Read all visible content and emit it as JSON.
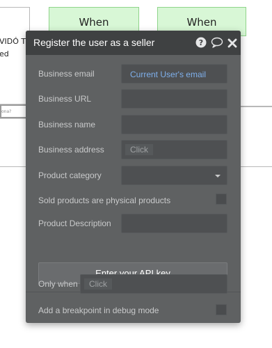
{
  "background": {
    "left_card": {
      "line1": "VIDÓ TU",
      "line2": "ed"
    },
    "when_cards": [
      "When",
      "When"
    ],
    "mini_input_text": "ona?"
  },
  "modal": {
    "title": "Register the user as a seller",
    "header_icons": [
      "help-icon",
      "comment-icon",
      "close-icon"
    ],
    "fields": {
      "business_email": {
        "label": "Business email",
        "value": "Current User's email"
      },
      "business_url": {
        "label": "Business URL",
        "value": ""
      },
      "business_name": {
        "label": "Business name",
        "value": ""
      },
      "business_address": {
        "label": "Business address",
        "placeholder": "Click"
      },
      "product_category": {
        "label": "Product category",
        "value": ""
      },
      "physical_products": {
        "label": "Sold products are physical products",
        "checked": false
      },
      "product_description": {
        "label": "Product Description",
        "value": ""
      }
    },
    "api_button_label": "Enter your API key",
    "only_when": {
      "label": "Only when",
      "placeholder": "Click"
    },
    "breakpoint": {
      "label": "Add a breakpoint in debug mode",
      "checked": false
    }
  },
  "colors": {
    "modal_bg": "#5f6162",
    "header_bg": "#3f4142",
    "field_bg": "#4e5052",
    "dynamic_value": "#7fb0ec",
    "when_card_bg": "#d8f7d6",
    "when_card_border": "#8fd48a"
  }
}
